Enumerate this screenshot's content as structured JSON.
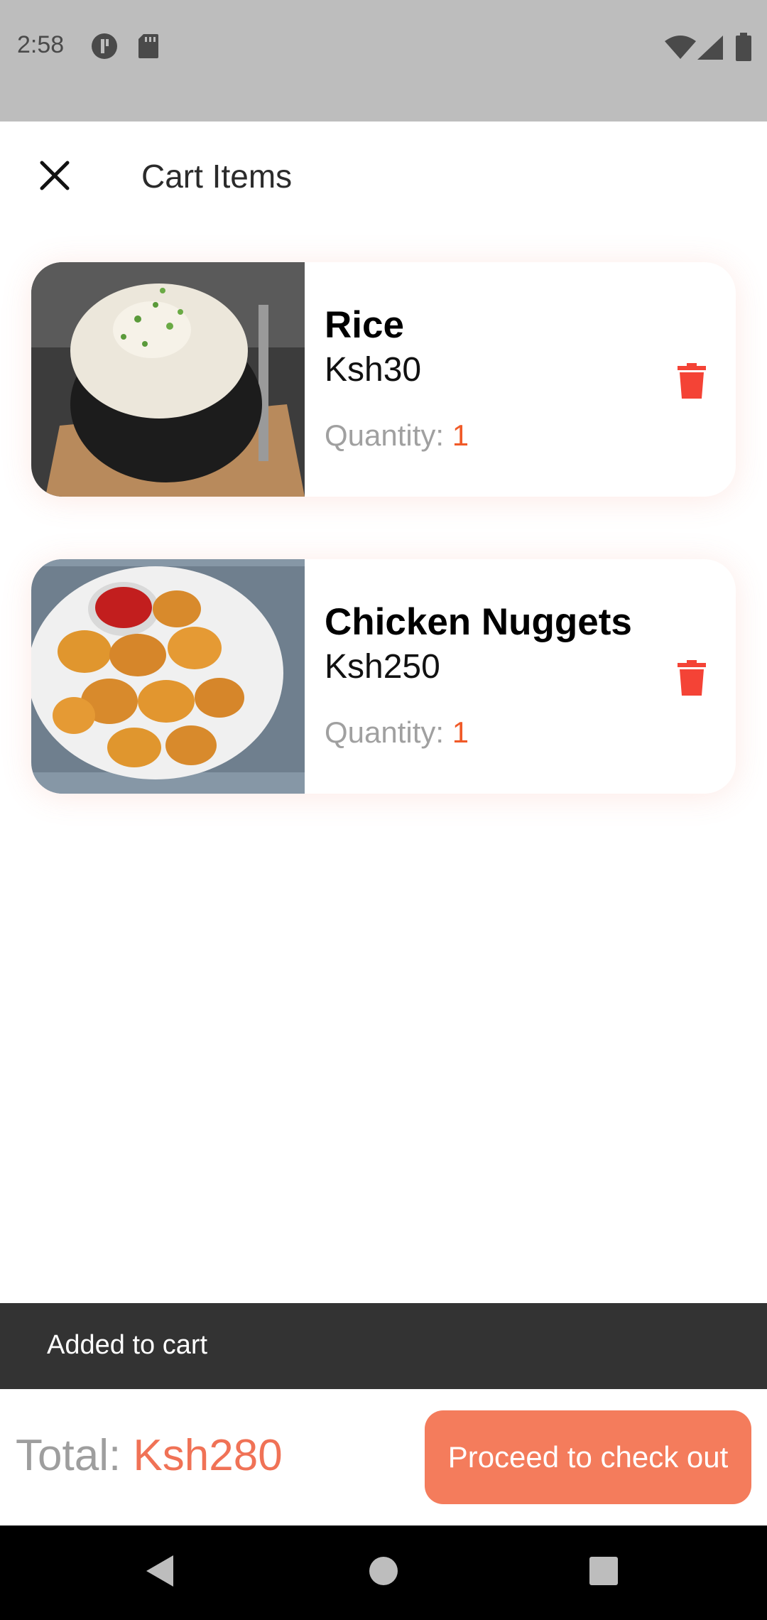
{
  "status_bar": {
    "time": "2:58"
  },
  "header": {
    "title": "Cart Items",
    "close_icon": "close-icon"
  },
  "cart": {
    "items": [
      {
        "name": "Rice",
        "price": "Ksh30",
        "quantity_label": "Quantity: ",
        "quantity": "1",
        "image": "rice-bowl-photo",
        "delete_icon": "trash-icon"
      },
      {
        "name": "Chicken Nuggets",
        "price": "Ksh250",
        "quantity_label": "Quantity: ",
        "quantity": "1",
        "image": "chicken-nuggets-photo",
        "delete_icon": "trash-icon"
      }
    ]
  },
  "snackbar": {
    "message": "Added to cart"
  },
  "footer": {
    "total_label": "Total: ",
    "total_value": "Ksh280",
    "checkout_label": "Proceed to check out"
  },
  "colors": {
    "accent": "#f47c5c",
    "quantity": "#f05a28",
    "delete": "#f44336",
    "snackbar": "#333333",
    "status_bar": "#bdbdbd"
  }
}
